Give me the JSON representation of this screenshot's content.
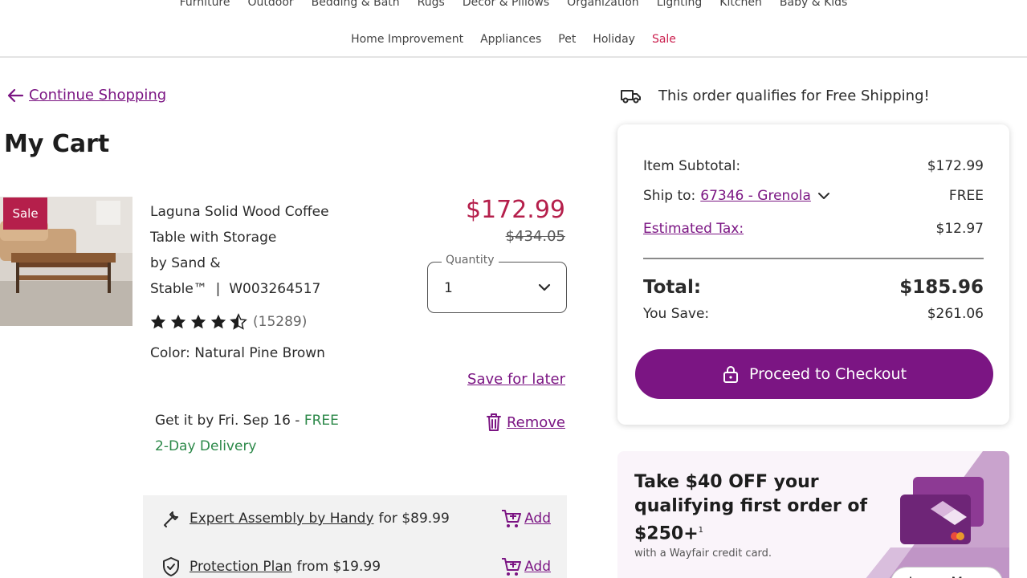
{
  "nav": {
    "row1": [
      "Furniture",
      "Outdoor",
      "Bedding & Bath",
      "Rugs",
      "Decor & Pillows",
      "Organization",
      "Lighting",
      "Kitchen",
      "Baby & Kids"
    ],
    "row2": [
      "Home Improvement",
      "Appliances",
      "Pet",
      "Holiday",
      "Sale"
    ]
  },
  "cart": {
    "continue_label": "Continue Shopping",
    "title": "My Cart",
    "item": {
      "badge": "Sale",
      "name_line1": "Laguna Solid Wood Coffee",
      "name_line2": "Table with Storage",
      "name_line3": "by Sand &",
      "name_line4": "Stable™",
      "sku": "W003264517",
      "rating_count": "(15289)",
      "rating_value": 4.5,
      "color": "Color: Natural Pine Brown",
      "price": "$172.99",
      "original_price": "$434.05",
      "quantity_label": "Quantity",
      "quantity_value": "1",
      "save_for_later": "Save for later",
      "remove": "Remove",
      "delivery_prefix": "Get it by Fri. Sep 16 - ",
      "delivery_free": "FREE",
      "delivery_line2": "2-Day Delivery"
    },
    "services": [
      {
        "link": "Expert Assembly by Handy",
        "suffix": "for $89.99",
        "action": "Add",
        "icon": "wrench-icon"
      },
      {
        "link": "Protection Plan",
        "suffix": "from $19.99",
        "action": "Add",
        "icon": "shield-check-icon"
      }
    ]
  },
  "summary": {
    "shipping_banner": "This order qualifies for Free Shipping!",
    "subtotal_label": "Item Subtotal:",
    "subtotal_value": "$172.99",
    "ship_to_label": "Ship to:",
    "ship_to_zip": "67346 - Grenola",
    "ship_value": "FREE",
    "tax_label": "Estimated Tax:",
    "tax_value": "$12.97",
    "total_label": "Total:",
    "total_value": "$185.96",
    "save_label": "You Save:",
    "save_value": "$261.06",
    "checkout_label": "Proceed to Checkout"
  },
  "promo": {
    "title_line1": "Take $40 OFF your",
    "title_line2": "qualifying first order of",
    "title_line3": "$250+",
    "title_sup": "1",
    "subtitle": "with a Wayfair credit card.",
    "learn_more": "Learn More"
  },
  "colors": {
    "brand_purple": "#7b1583",
    "sale_red": "#b51f4b",
    "free_green": "#2b8848"
  }
}
